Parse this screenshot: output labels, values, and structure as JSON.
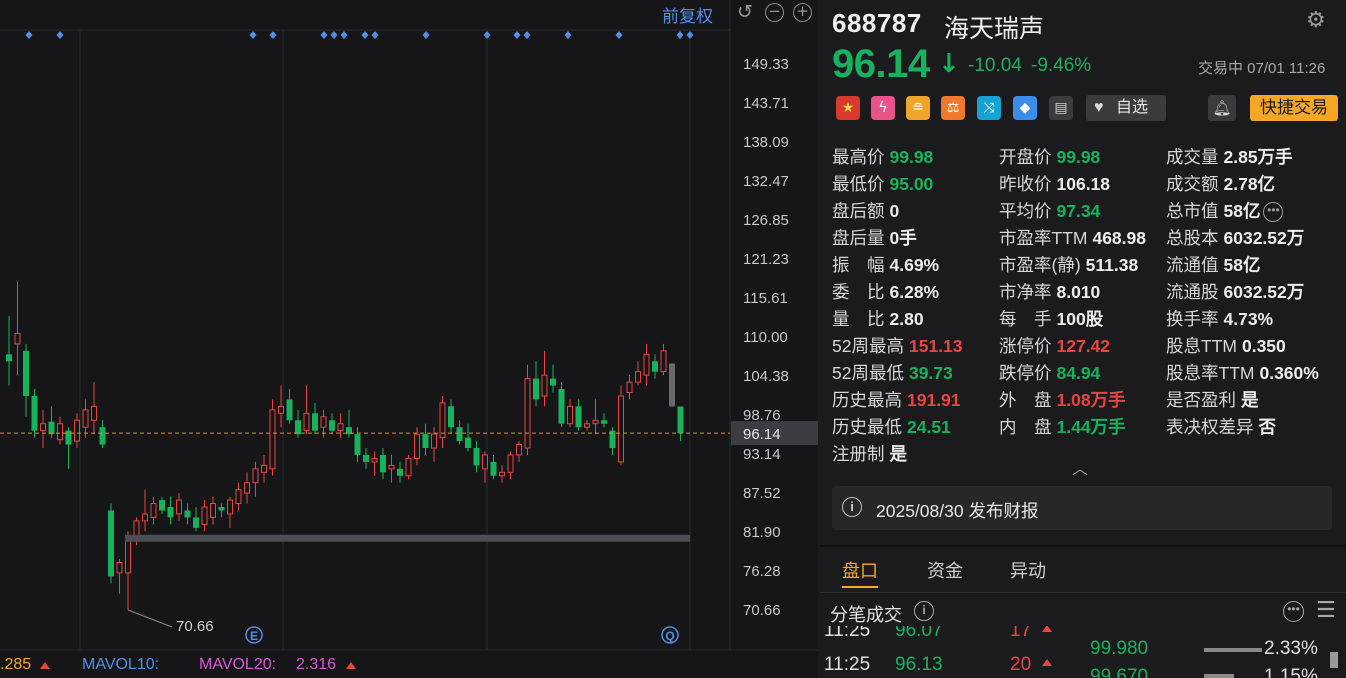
{
  "toolbar": {
    "adjust_label": "前复权",
    "zoom_out": "−",
    "zoom_in": "+",
    "undo": "↺"
  },
  "chart_data": {
    "type": "candlestick",
    "y_ticks": [
      "149.33",
      "143.71",
      "138.09",
      "132.47",
      "126.85",
      "121.23",
      "115.61",
      "110.00",
      "104.38",
      "98.76",
      "93.14",
      "87.52",
      "81.90",
      "76.28",
      "70.66"
    ],
    "current_price_label": "96.14",
    "low_marker_label": "70.66",
    "grid": true,
    "candles": [
      {
        "o": 107.5,
        "h": 113.0,
        "l": 103.0,
        "c": 106.5
      },
      {
        "o": 109.0,
        "h": 118.0,
        "l": 104.5,
        "c": 110.5
      },
      {
        "o": 108.0,
        "h": 109.0,
        "l": 98.5,
        "c": 101.5
      },
      {
        "o": 101.5,
        "h": 102.5,
        "l": 95.5,
        "c": 96.5
      },
      {
        "o": 96.5,
        "h": 99.5,
        "l": 94.0,
        "c": 97.5
      },
      {
        "o": 97.8,
        "h": 100.0,
        "l": 95.5,
        "c": 96.0
      },
      {
        "o": 95.2,
        "h": 98.5,
        "l": 94.5,
        "c": 97.5
      },
      {
        "o": 96.5,
        "h": 97.0,
        "l": 91.0,
        "c": 94.5
      },
      {
        "o": 95.0,
        "h": 99.0,
        "l": 94.0,
        "c": 98.0
      },
      {
        "o": 97.0,
        "h": 101.0,
        "l": 95.5,
        "c": 99.5
      },
      {
        "o": 98.0,
        "h": 103.5,
        "l": 96.0,
        "c": 100.0
      },
      {
        "o": 97.0,
        "h": 98.0,
        "l": 94.0,
        "c": 94.5
      },
      {
        "o": 85.0,
        "h": 86.0,
        "l": 74.5,
        "c": 75.5
      },
      {
        "o": 76.0,
        "h": 78.0,
        "l": 73.0,
        "c": 77.5
      },
      {
        "o": 76.0,
        "h": 82.0,
        "l": 70.66,
        "c": 81.0
      },
      {
        "o": 81.0,
        "h": 84.0,
        "l": 80.0,
        "c": 83.5
      },
      {
        "o": 83.5,
        "h": 88.0,
        "l": 82.0,
        "c": 84.5
      },
      {
        "o": 84.0,
        "h": 87.0,
        "l": 83.0,
        "c": 86.0
      },
      {
        "o": 86.5,
        "h": 87.0,
        "l": 84.5,
        "c": 85.0
      },
      {
        "o": 85.5,
        "h": 87.0,
        "l": 83.0,
        "c": 84.0
      },
      {
        "o": 84.5,
        "h": 87.5,
        "l": 83.5,
        "c": 86.5
      },
      {
        "o": 85.0,
        "h": 86.0,
        "l": 83.0,
        "c": 84.0
      },
      {
        "o": 84.0,
        "h": 85.5,
        "l": 82.0,
        "c": 82.5
      },
      {
        "o": 83.0,
        "h": 86.5,
        "l": 82.0,
        "c": 85.5
      },
      {
        "o": 84.0,
        "h": 87.0,
        "l": 83.0,
        "c": 86.0
      },
      {
        "o": 85.5,
        "h": 86.0,
        "l": 84.0,
        "c": 85.0
      },
      {
        "o": 84.5,
        "h": 87.0,
        "l": 82.5,
        "c": 86.5
      },
      {
        "o": 86.0,
        "h": 89.0,
        "l": 85.0,
        "c": 88.0
      },
      {
        "o": 87.5,
        "h": 90.5,
        "l": 86.0,
        "c": 89.0
      },
      {
        "o": 89.0,
        "h": 92.0,
        "l": 87.0,
        "c": 91.0
      },
      {
        "o": 90.5,
        "h": 93.0,
        "l": 89.0,
        "c": 91.5
      },
      {
        "o": 91.0,
        "h": 101.0,
        "l": 90.0,
        "c": 99.5
      },
      {
        "o": 99.0,
        "h": 103.0,
        "l": 97.0,
        "c": 100.0
      },
      {
        "o": 101.0,
        "h": 102.5,
        "l": 97.5,
        "c": 98.0
      },
      {
        "o": 98.0,
        "h": 99.5,
        "l": 95.5,
        "c": 96.0
      },
      {
        "o": 96.5,
        "h": 103.0,
        "l": 96.0,
        "c": 99.0
      },
      {
        "o": 99.0,
        "h": 100.5,
        "l": 96.0,
        "c": 96.5
      },
      {
        "o": 97.0,
        "h": 99.5,
        "l": 95.5,
        "c": 98.5
      },
      {
        "o": 98.0,
        "h": 99.0,
        "l": 96.0,
        "c": 96.5
      },
      {
        "o": 96.5,
        "h": 99.0,
        "l": 95.5,
        "c": 97.5
      },
      {
        "o": 97.0,
        "h": 99.5,
        "l": 95.5,
        "c": 96.0
      },
      {
        "o": 96.0,
        "h": 97.0,
        "l": 92.0,
        "c": 93.0
      },
      {
        "o": 93.0,
        "h": 94.0,
        "l": 91.0,
        "c": 92.0
      },
      {
        "o": 92.0,
        "h": 93.5,
        "l": 90.0,
        "c": 92.5
      },
      {
        "o": 93.0,
        "h": 94.0,
        "l": 89.5,
        "c": 90.5
      },
      {
        "o": 91.0,
        "h": 93.0,
        "l": 89.0,
        "c": 91.5
      },
      {
        "o": 91.0,
        "h": 92.0,
        "l": 89.0,
        "c": 90.0
      },
      {
        "o": 90.0,
        "h": 93.0,
        "l": 89.5,
        "c": 92.5
      },
      {
        "o": 92.5,
        "h": 97.0,
        "l": 91.5,
        "c": 96.0
      },
      {
        "o": 96.0,
        "h": 97.5,
        "l": 93.0,
        "c": 94.0
      },
      {
        "o": 94.0,
        "h": 97.0,
        "l": 92.0,
        "c": 96.0
      },
      {
        "o": 95.5,
        "h": 101.5,
        "l": 94.0,
        "c": 100.5
      },
      {
        "o": 100.0,
        "h": 101.0,
        "l": 96.0,
        "c": 97.0
      },
      {
        "o": 97.0,
        "h": 98.0,
        "l": 94.5,
        "c": 95.0
      },
      {
        "o": 95.5,
        "h": 97.5,
        "l": 93.5,
        "c": 94.0
      },
      {
        "o": 94.0,
        "h": 95.0,
        "l": 90.5,
        "c": 91.5
      },
      {
        "o": 91.0,
        "h": 93.5,
        "l": 89.0,
        "c": 93.0
      },
      {
        "o": 92.0,
        "h": 93.0,
        "l": 89.5,
        "c": 90.0
      },
      {
        "o": 90.0,
        "h": 91.5,
        "l": 89.0,
        "c": 90.5
      },
      {
        "o": 90.5,
        "h": 93.5,
        "l": 89.5,
        "c": 93.0
      },
      {
        "o": 93.0,
        "h": 95.0,
        "l": 92.0,
        "c": 94.5
      },
      {
        "o": 94.0,
        "h": 106.0,
        "l": 93.0,
        "c": 104.0
      },
      {
        "o": 104.0,
        "h": 106.5,
        "l": 100.0,
        "c": 101.0
      },
      {
        "o": 101.5,
        "h": 108.0,
        "l": 100.0,
        "c": 104.5
      },
      {
        "o": 104.0,
        "h": 106.0,
        "l": 102.0,
        "c": 103.0
      },
      {
        "o": 102.5,
        "h": 103.5,
        "l": 97.0,
        "c": 97.5
      },
      {
        "o": 97.5,
        "h": 101.0,
        "l": 97.0,
        "c": 100.0
      },
      {
        "o": 100.0,
        "h": 101.0,
        "l": 96.5,
        "c": 97.0
      },
      {
        "o": 97.0,
        "h": 98.0,
        "l": 96.5,
        "c": 97.5
      },
      {
        "o": 97.5,
        "h": 101.0,
        "l": 96.0,
        "c": 98.0
      },
      {
        "o": 98.0,
        "h": 99.0,
        "l": 97.0,
        "c": 97.5
      },
      {
        "o": 96.5,
        "h": 97.0,
        "l": 93.0,
        "c": 94.0
      },
      {
        "o": 92.0,
        "h": 103.0,
        "l": 91.5,
        "c": 101.5
      },
      {
        "o": 102.0,
        "h": 104.5,
        "l": 101.0,
        "c": 103.5
      },
      {
        "o": 103.5,
        "h": 106.5,
        "l": 103.0,
        "c": 105.0
      },
      {
        "o": 104.5,
        "h": 109.0,
        "l": 103.0,
        "c": 107.5
      },
      {
        "o": 106.5,
        "h": 107.5,
        "l": 104.0,
        "c": 105.0
      },
      {
        "o": 105.0,
        "h": 109.0,
        "l": 104.5,
        "c": 108.0
      },
      {
        "o": 106.18,
        "h": 106.18,
        "l": 99.98,
        "c": 99.98,
        "hollow": true
      },
      {
        "o": 99.98,
        "h": 99.98,
        "l": 95.0,
        "c": 96.14
      }
    ],
    "support_band": {
      "from_index": 14,
      "price": 81.0
    },
    "event_marker_E": "E",
    "event_marker_Q": "Q"
  },
  "volume_bar": {
    "mavol5_value": ".285",
    "mavol10_label": "MAVOL10:",
    "mavol20_label": "MAVOL20:",
    "mavol20_value": "2.316"
  },
  "quote": {
    "code": "688787",
    "name": "海天瑞声",
    "price": "96.14",
    "change": "-10.04",
    "change_pct": "-9.46%",
    "status": "交易中 07/01 11:26",
    "fav_label": "自选",
    "quick_trade_label": "快捷交易"
  },
  "stats": {
    "high": {
      "label": "最高价",
      "value": "99.98"
    },
    "low": {
      "label": "最低价",
      "value": "95.00"
    },
    "after_amt": {
      "label": "盘后额",
      "value": "0"
    },
    "after_vol": {
      "label": "盘后量",
      "value": "0手"
    },
    "amplitude": {
      "label": "振　幅",
      "value": "4.69%"
    },
    "commit_ratio": {
      "label": "委　比",
      "value": "6.28%"
    },
    "vol_ratio": {
      "label": "量　比",
      "value": "2.80"
    },
    "high52": {
      "label": "52周最高",
      "value": "151.13"
    },
    "low52": {
      "label": "52周最低",
      "value": "39.73"
    },
    "hist_high": {
      "label": "历史最高",
      "value": "191.91"
    },
    "hist_low": {
      "label": "历史最低",
      "value": "24.51"
    },
    "registered": {
      "label": "注册制",
      "value": "是"
    },
    "open": {
      "label": "开盘价",
      "value": "99.98"
    },
    "prev_close": {
      "label": "昨收价",
      "value": "106.18"
    },
    "avg": {
      "label": "平均价",
      "value": "97.34"
    },
    "pe_ttm": {
      "label": "市盈率TTM",
      "value": "468.98"
    },
    "pe_static": {
      "label": "市盈率(静)",
      "value": "511.38"
    },
    "pb": {
      "label": "市净率",
      "value": "8.010"
    },
    "lot": {
      "label": "每　手",
      "value": "100股"
    },
    "limit_up": {
      "label": "涨停价",
      "value": "127.42"
    },
    "limit_down": {
      "label": "跌停价",
      "value": "84.94"
    },
    "outer": {
      "label": "外　盘",
      "value": "1.08万手"
    },
    "inner": {
      "label": "内　盘",
      "value": "1.44万手"
    },
    "volume": {
      "label": "成交量",
      "value": "2.85万手"
    },
    "turnover": {
      "label": "成交额",
      "value": "2.78亿"
    },
    "mkt_cap": {
      "label": "总市值",
      "value": "58亿"
    },
    "total_shares": {
      "label": "总股本",
      "value": "6032.52万"
    },
    "float_cap": {
      "label": "流通值",
      "value": "58亿"
    },
    "float_shares": {
      "label": "流通股",
      "value": "6032.52万"
    },
    "turnover_rate": {
      "label": "换手率",
      "value": "4.73%"
    },
    "dividend_ttm": {
      "label": "股息TTM",
      "value": "0.350"
    },
    "div_yield": {
      "label": "股息率TTM",
      "value": "0.360%"
    },
    "profitable": {
      "label": "是否盈利",
      "value": "是"
    },
    "vote_diff": {
      "label": "表决权差异",
      "value": "否"
    }
  },
  "report": {
    "icon": "i",
    "text": "2025/08/30  发布财报"
  },
  "tabs": [
    "盘口",
    "资金",
    "异动"
  ],
  "ticks": {
    "title": "分笔成交",
    "rows": [
      {
        "time": "11:25",
        "price": "96.07",
        "qty": "17"
      },
      {
        "time": "11:25",
        "price": "96.13",
        "qty": "20"
      }
    ],
    "depth": [
      {
        "price": "99.980",
        "pct": "2.33%"
      },
      {
        "price": "99.670",
        "pct": "1.15%"
      }
    ]
  },
  "colors": {
    "up": "#e94444",
    "down": "#17b25e",
    "accent": "#f5a623",
    "link": "#4f8fe8"
  }
}
